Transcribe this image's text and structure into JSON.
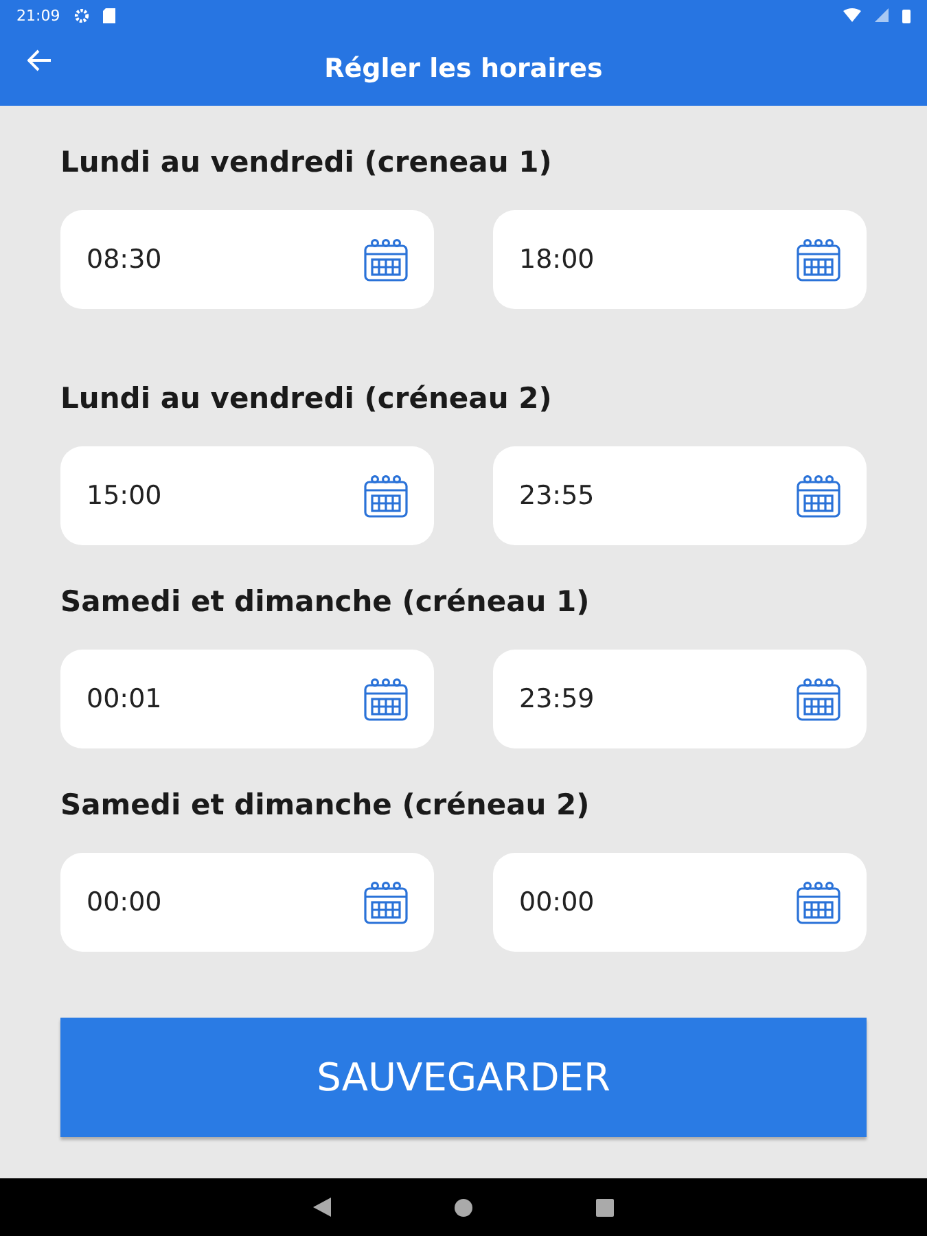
{
  "status_bar": {
    "time": "21:09"
  },
  "app_bar": {
    "title": "Régler les horaires"
  },
  "sections": [
    {
      "title": "Lundi au vendredi (creneau 1)",
      "fields": [
        "08:30",
        "18:00"
      ]
    },
    {
      "title": "Lundi au vendredi (créneau 2)",
      "fields": [
        "15:00",
        "23:55"
      ]
    },
    {
      "title": "Samedi et dimanche (créneau 1)",
      "fields": [
        "00:01",
        "23:59"
      ]
    },
    {
      "title": "Samedi et dimanche (créneau 2)",
      "fields": [
        "00:00",
        "00:00"
      ]
    }
  ],
  "save_button": "SAUVEGARDER"
}
